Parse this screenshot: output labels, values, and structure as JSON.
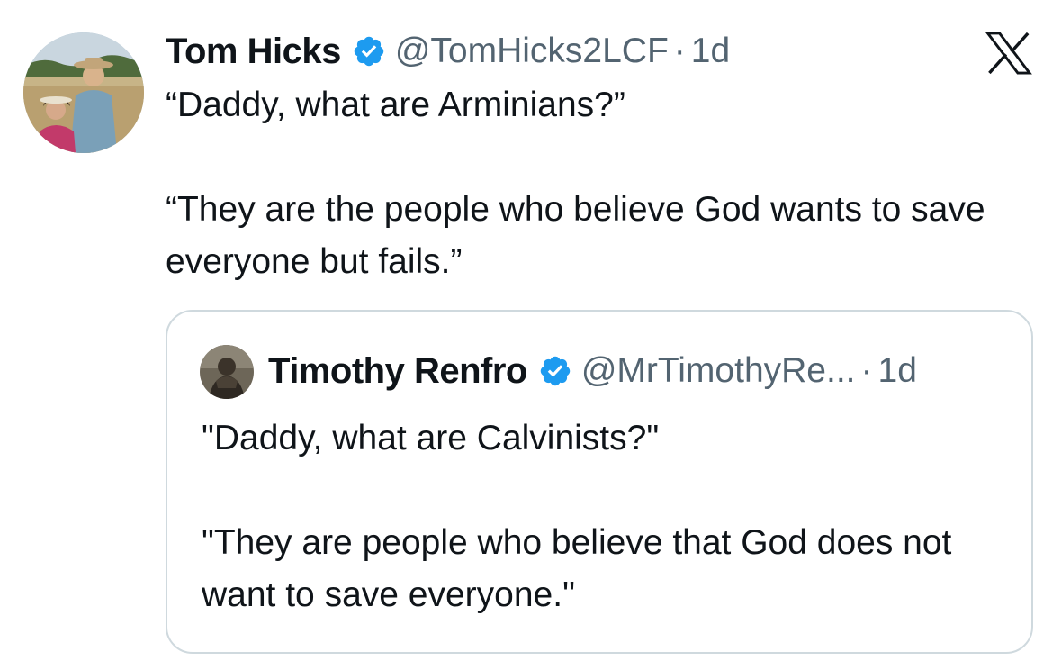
{
  "tweet": {
    "author_name": "Tom Hicks",
    "handle": "@TomHicks2LCF",
    "separator": "·",
    "timestamp": "1d",
    "text_line_1": "“Daddy, what are Arminians?”",
    "text_line_2": "“They are the people who believe God wants to save everyone but fails.”",
    "verified_icon": "verified-badge-icon",
    "platform_icon": "x-logo-icon"
  },
  "quoted_tweet": {
    "author_name": "Timothy Renfro",
    "handle": "@MrTimothyRe...",
    "separator": "·",
    "timestamp": "1d",
    "text_line_1": "\"Daddy, what are Calvinists?\"",
    "text_line_2": "\"They are people who believe that God does not want to save everyone.\""
  },
  "colors": {
    "verified_blue": "#1d9bf0",
    "secondary_text": "#536471",
    "border": "#cfd9de",
    "primary_text": "#0f1419"
  }
}
